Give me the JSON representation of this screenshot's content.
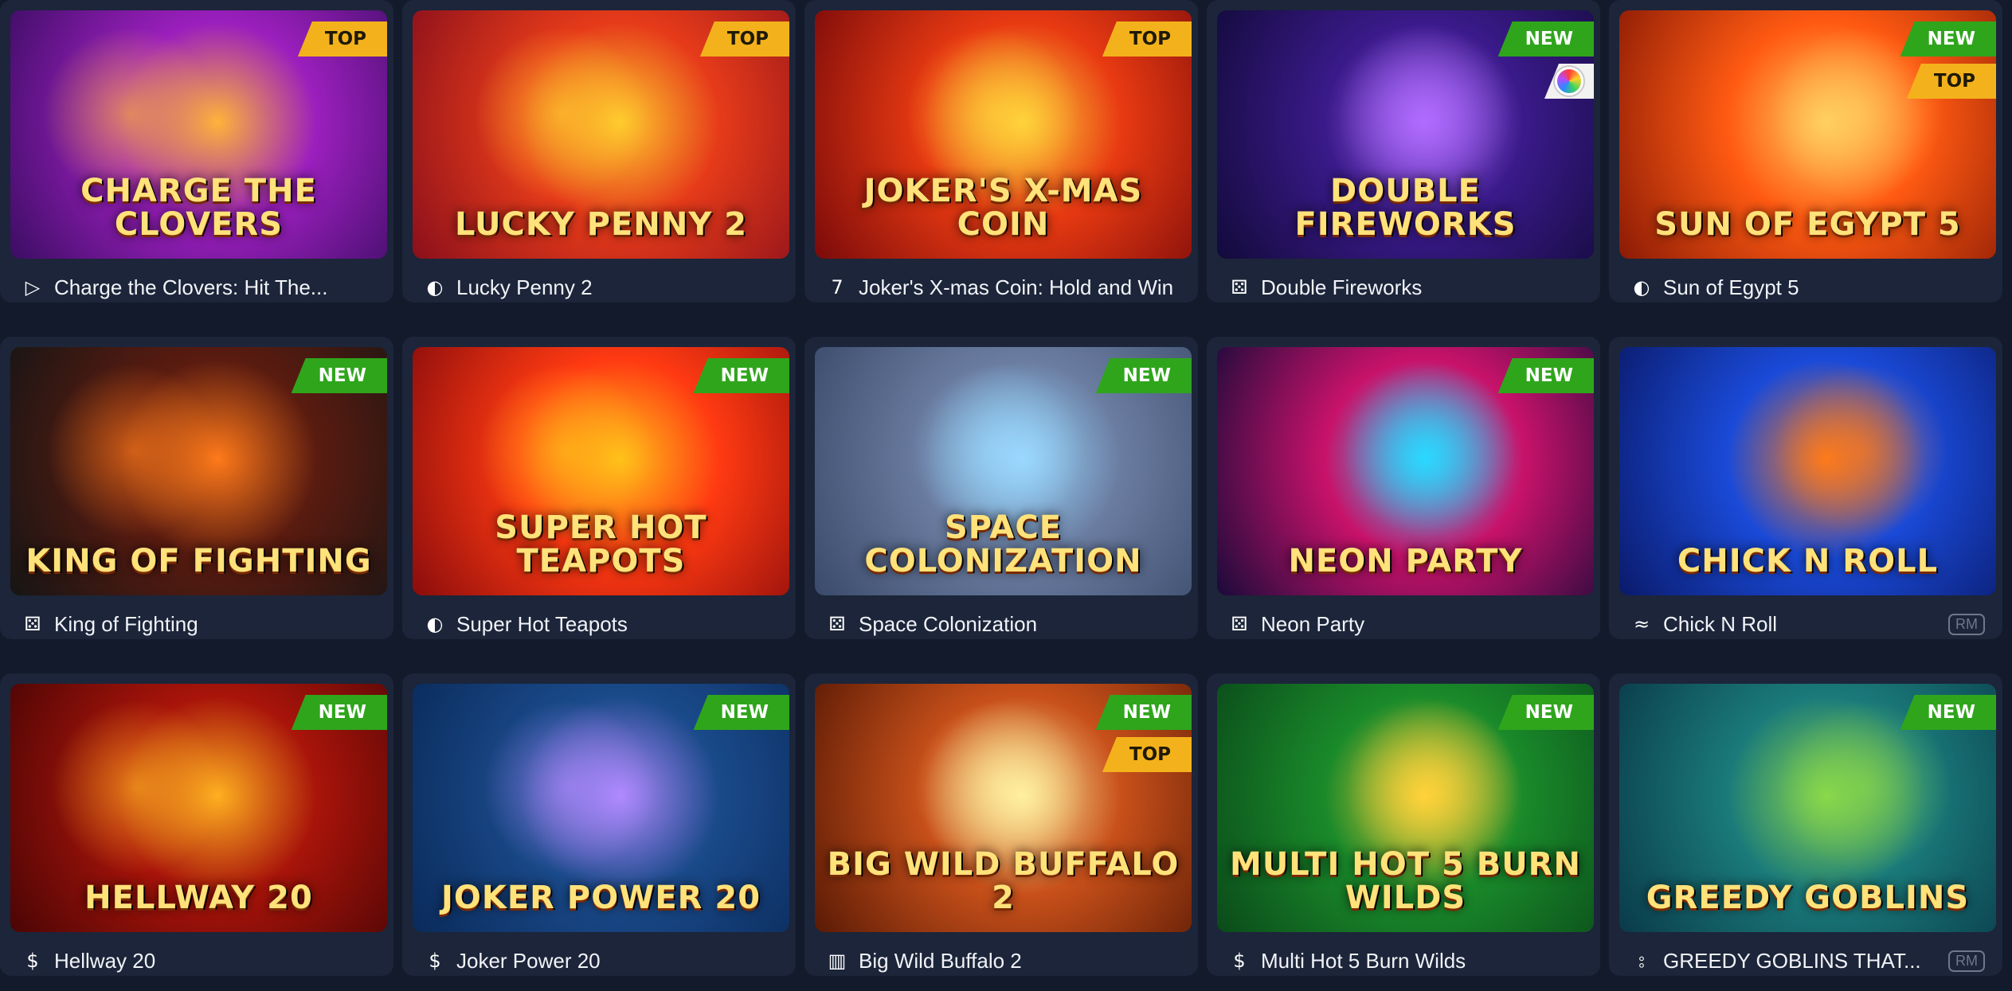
{
  "games": [
    {
      "name": "Charge the Clovers: Hit The...",
      "art_title": "CHARGE THE CLOVERS",
      "badges": [
        "TOP"
      ],
      "provider_icon": "play-triangle-icon",
      "rm": "",
      "colors": [
        "#3b0d63",
        "#9b1fbd",
        "#ffb33a"
      ]
    },
    {
      "name": "Lucky Penny 2",
      "art_title": "LUCKY PENNY 2",
      "badges": [
        "TOP"
      ],
      "provider_icon": "coin-d-icon",
      "rm": "",
      "colors": [
        "#8a0f1b",
        "#e63b1a",
        "#ffcc2e"
      ]
    },
    {
      "name": "Joker's X-mas Coin: Hold and Win",
      "art_title": "JOKER'S X-MAS COIN",
      "badges": [
        "TOP"
      ],
      "provider_icon": "seven-icon",
      "rm": "",
      "colors": [
        "#7a0a0a",
        "#e83a12",
        "#ffd33a"
      ]
    },
    {
      "name": "Double Fireworks",
      "art_title": "DOUBLE FIREWORKS",
      "badges": [
        "NEW",
        "chip"
      ],
      "provider_icon": "dice-icon",
      "rm": "",
      "colors": [
        "#120a3a",
        "#3a1a8a",
        "#b06bff"
      ]
    },
    {
      "name": "Sun of Egypt 5",
      "art_title": "SUN OF EGYPT 5",
      "badges": [
        "NEW",
        "TOP"
      ],
      "provider_icon": "coin-d-icon",
      "rm": "",
      "colors": [
        "#8a1a05",
        "#ff5a12",
        "#ffd060"
      ]
    },
    {
      "name": "King of Fighting",
      "art_title": "KING OF FIGHTING",
      "badges": [
        "NEW"
      ],
      "provider_icon": "dice-icon",
      "rm": "",
      "colors": [
        "#151515",
        "#5a1b10",
        "#ff7a1a"
      ]
    },
    {
      "name": "Super Hot Teapots",
      "art_title": "SUPER HOT TEAPOTS",
      "badges": [
        "NEW"
      ],
      "provider_icon": "coin-d-icon",
      "rm": "",
      "colors": [
        "#8a0c0c",
        "#ff3a12",
        "#ffc21a"
      ]
    },
    {
      "name": "Space Colonization",
      "art_title": "SPACE COLONIZATION",
      "badges": [
        "NEW"
      ],
      "provider_icon": "dice-icon",
      "rm": "",
      "colors": [
        "#3a4a6a",
        "#6a7ca0",
        "#9ad8ff"
      ]
    },
    {
      "name": "Neon Party",
      "art_title": "NEON PARTY",
      "badges": [
        "NEW"
      ],
      "provider_icon": "dice-icon",
      "rm": "",
      "colors": [
        "#1a0a3a",
        "#c8126a",
        "#2ad8ff"
      ]
    },
    {
      "name": "Chick N Roll",
      "art_title": "CHICK N ROLL",
      "badges": [],
      "provider_icon": "wave-icon",
      "rm": "RM",
      "colors": [
        "#0a1a6a",
        "#1a4ad8",
        "#ff7a1a"
      ]
    },
    {
      "name": "Hellway 20",
      "art_title": "HELLWAY 20",
      "badges": [
        "NEW"
      ],
      "provider_icon": "slot-s-icon",
      "rm": "",
      "colors": [
        "#4a0505",
        "#a8140a",
        "#ffb020"
      ]
    },
    {
      "name": "Joker Power 20",
      "art_title": "JOKER POWER 20",
      "badges": [
        "NEW"
      ],
      "provider_icon": "slot-s-icon",
      "rm": "",
      "colors": [
        "#0a2a5a",
        "#1a4a8a",
        "#b08aff"
      ]
    },
    {
      "name": "Big Wild Buffalo 2",
      "art_title": "BIG WILD BUFFALO 2",
      "badges": [
        "NEW",
        "TOP"
      ],
      "provider_icon": "bracket-icon",
      "rm": "",
      "colors": [
        "#5a1a05",
        "#c8501a",
        "#fff0a0"
      ]
    },
    {
      "name": "Multi Hot 5 Burn Wilds",
      "art_title": "MULTI HOT 5 BURN WILDS",
      "badges": [
        "NEW"
      ],
      "provider_icon": "dollar-icon",
      "rm": "",
      "colors": [
        "#0a4a1a",
        "#1a8a2a",
        "#ffd23a"
      ]
    },
    {
      "name": "GREEDY GOBLINS THAT...",
      "art_title": "GREEDY GOBLINS",
      "badges": [
        "NEW"
      ],
      "provider_icon": "ds-icon",
      "rm": "RM",
      "colors": [
        "#0a3a4a",
        "#1a7a7a",
        "#8ad84a"
      ]
    }
  ],
  "badge_colors": {
    "NEW": "#2fa51c",
    "TOP": "#f3b21c"
  },
  "icon_glyphs": {
    "play-triangle-icon": "▷",
    "coin-d-icon": "◐",
    "seven-icon": "7",
    "dice-icon": "⚄",
    "wave-icon": "≈",
    "slot-s-icon": "$",
    "bracket-icon": "▥",
    "dollar-icon": "$",
    "ds-icon": "⦂"
  }
}
